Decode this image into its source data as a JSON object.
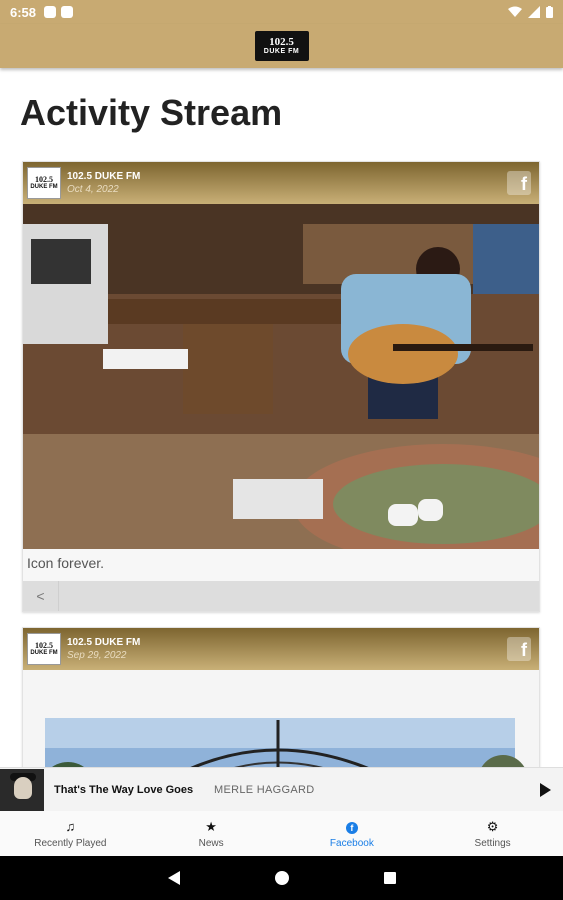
{
  "status": {
    "time": "6:58"
  },
  "header": {
    "logo_line1": "102.5",
    "logo_line2": "DUKE FM"
  },
  "page": {
    "title": "Activity Stream"
  },
  "posts": [
    {
      "source": "102.5 DUKE FM",
      "date": "Oct 4, 2022",
      "caption": "Icon forever.",
      "network_icon": "facebook-icon",
      "share_glyph": "<"
    },
    {
      "source": "102.5 DUKE FM",
      "date": "Sep 29, 2022",
      "network_icon": "facebook-icon"
    }
  ],
  "player": {
    "track": "That's The Way Love Goes",
    "artist": "MERLE HAGGARD"
  },
  "tabs": [
    {
      "label": "Recently Played",
      "icon": "music-note-icon",
      "glyph": "♫",
      "active": false
    },
    {
      "label": "News",
      "icon": "star-icon",
      "glyph": "★",
      "active": false
    },
    {
      "label": "Facebook",
      "icon": "facebook-icon",
      "glyph": "f",
      "active": true
    },
    {
      "label": "Settings",
      "icon": "gear-icon",
      "glyph": "⚙",
      "active": false
    }
  ],
  "colors": {
    "header": "#c8aa72",
    "accent": "#1a7ee6"
  }
}
